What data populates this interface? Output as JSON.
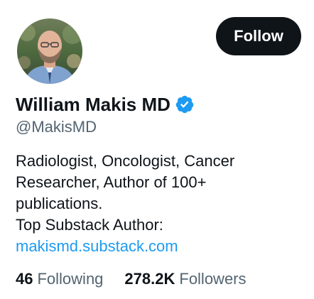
{
  "profile": {
    "display_name": "William Makis MD",
    "handle": "@MakisMD",
    "bio_lines": [
      "Radiologist, Oncologist, Cancer",
      "Researcher, Author of 100+",
      "publications.",
      "Top Substack Author:"
    ],
    "bio_link": "makismd.substack.com",
    "verified_icon": "verified-badge-icon"
  },
  "actions": {
    "follow_label": "Follow"
  },
  "stats": {
    "following_count": "46",
    "following_label": "Following",
    "followers_count": "278.2K",
    "followers_label": "Followers"
  },
  "colors": {
    "text_primary": "#0f1419",
    "text_secondary": "#536471",
    "link": "#1d9bf0",
    "verified": "#1d9bf0",
    "follow_button_bg": "#0f1419",
    "follow_button_text": "#ffffff"
  }
}
